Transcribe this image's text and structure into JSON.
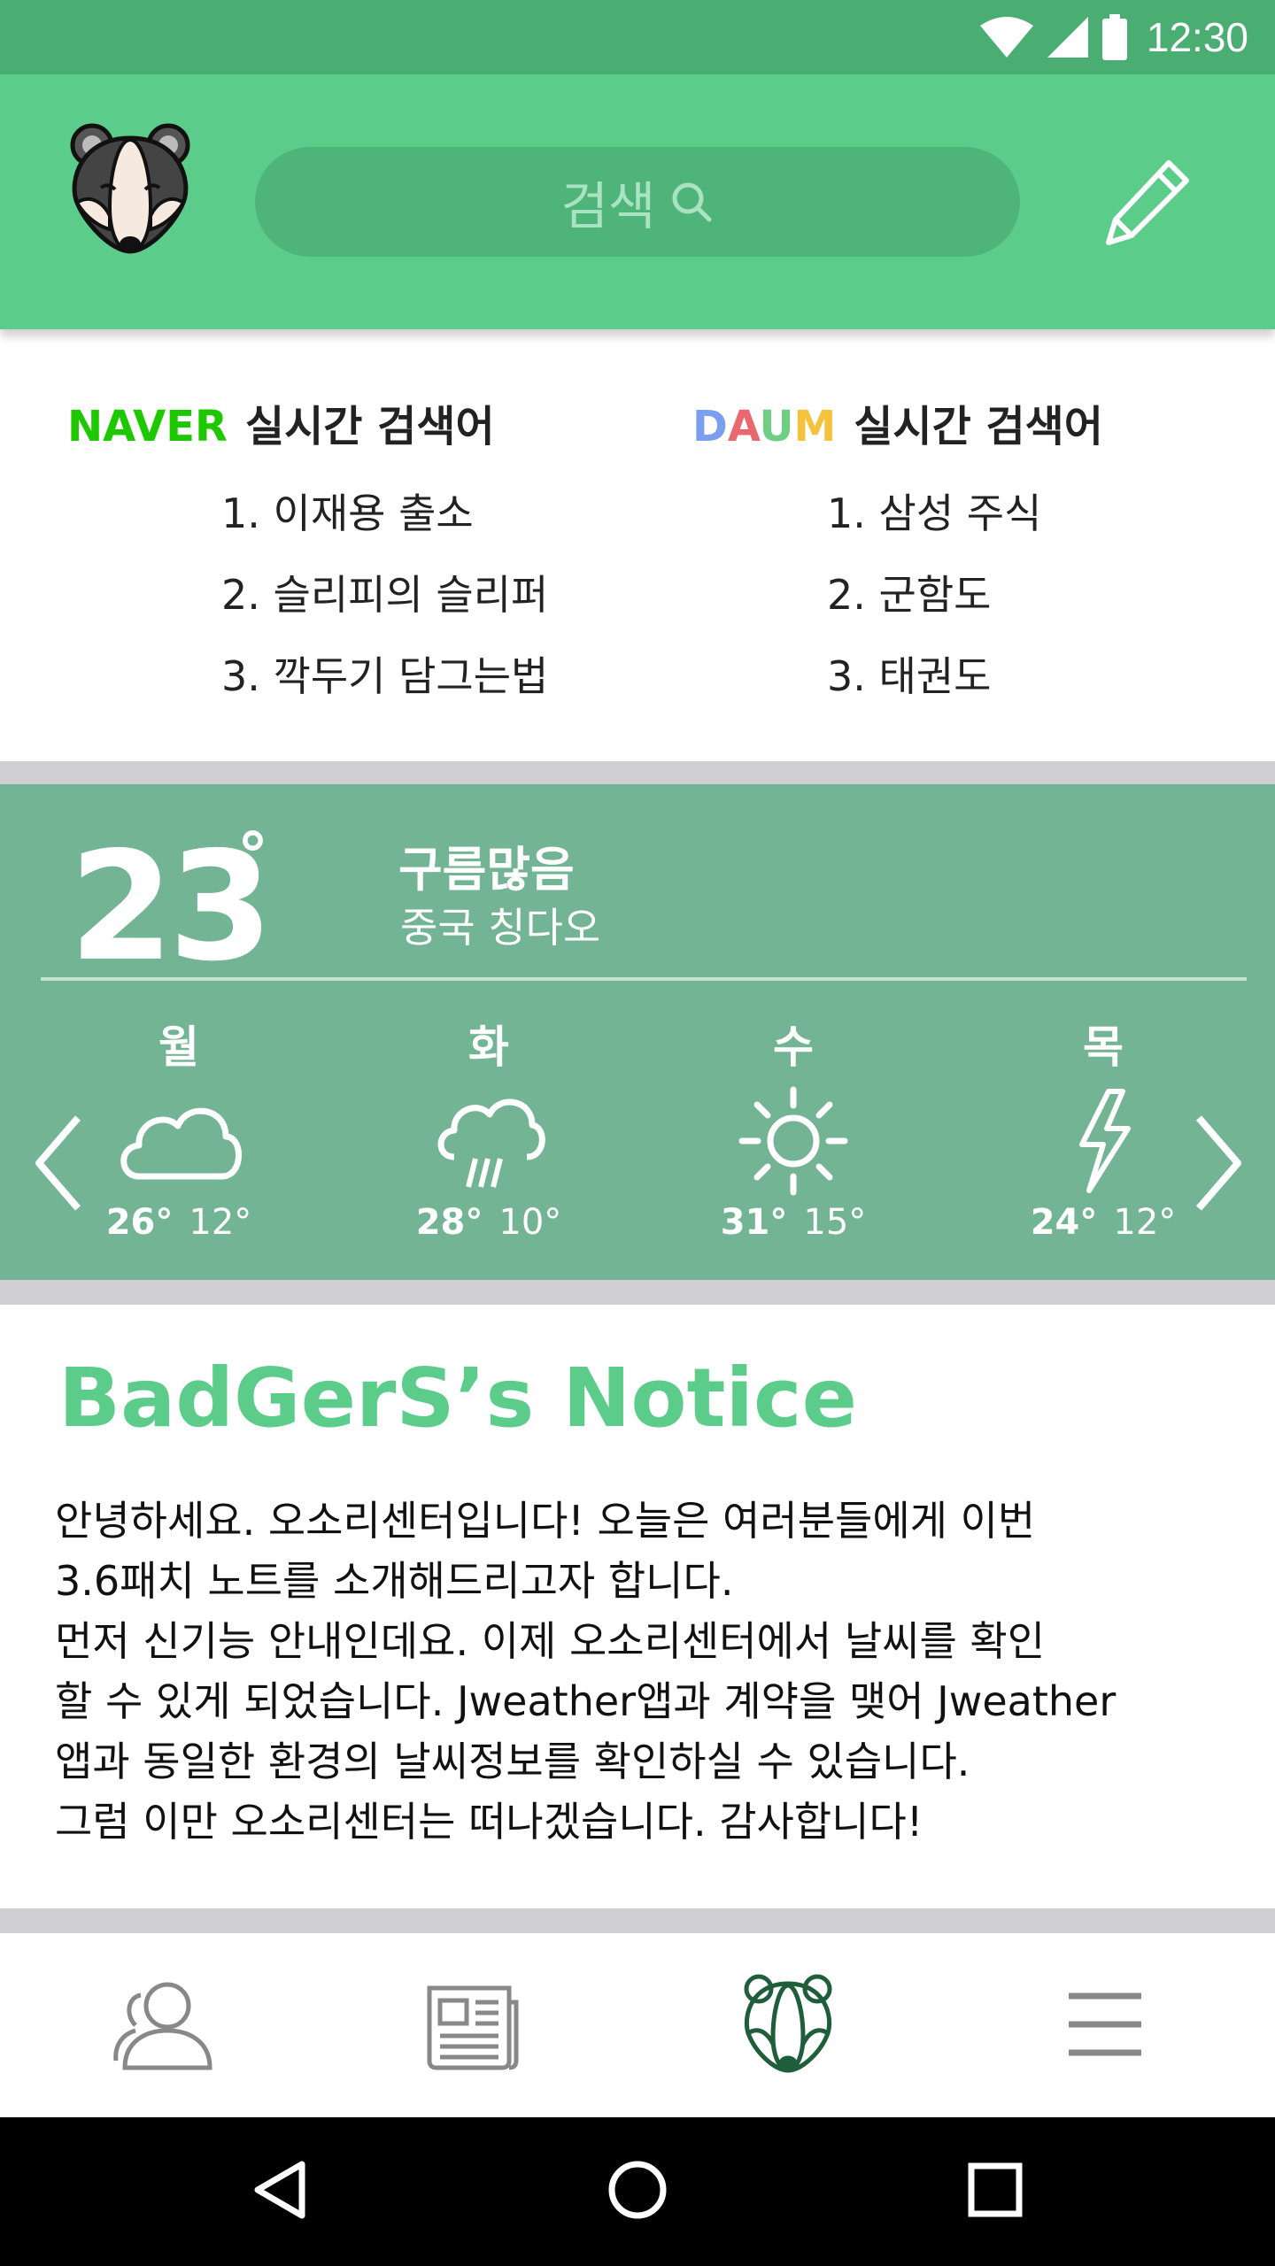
{
  "status_bar": {
    "time": "12:30",
    "icons": [
      "wifi-icon",
      "cellular-signal-icon",
      "battery-icon"
    ]
  },
  "app_bar": {
    "logo": "badger-logo",
    "search": {
      "placeholder": "검색",
      "icon": "search-icon"
    },
    "edit_icon": "pencil-icon",
    "colors": {
      "status_bar": "#4aae72",
      "app_bar": "#5ccc8b",
      "search_bg": "#4fb479"
    }
  },
  "trending": {
    "naver": {
      "brand": "NAVER",
      "title": "실시간 검색어",
      "items": [
        "1. 이재용 출소",
        "2. 슬리피의 슬리퍼",
        "3. 깍두기 담그는법"
      ]
    },
    "daum": {
      "brand_letters": [
        "D",
        "A",
        "U",
        "M"
      ],
      "title": "실시간 검색어",
      "items": [
        "1. 삼성 주식",
        "2. 군함도",
        "3. 태권도"
      ]
    }
  },
  "weather": {
    "current_temp": "23",
    "degree_symbol": "°",
    "condition": "구름많음",
    "location": "중국 칭다오",
    "forecast": [
      {
        "day": "월",
        "icon": "cloud-icon",
        "high": "26°",
        "low": "12°"
      },
      {
        "day": "화",
        "icon": "rain-icon",
        "high": "28°",
        "low": "10°"
      },
      {
        "day": "수",
        "icon": "sun-icon",
        "high": "31°",
        "low": "15°"
      },
      {
        "day": "목",
        "icon": "lightning-icon",
        "high": "24°",
        "low": "12°"
      }
    ],
    "colors": {
      "background": "#72b493"
    }
  },
  "notice": {
    "title": "BadGerS’s Notice",
    "lines": [
      "안녕하세요. 오소리센터입니다! 오늘은 여러분들에게 이번",
      "3.6패치 노트를 소개해드리고자 합니다.",
      "먼저 신기능 안내인데요. 이제 오소리센터에서 날씨를 확인",
      "할 수 있게 되었습니다. Jweather앱과 계약을 맺어 Jweather",
      "앱과 동일한 환경의 날씨정보를 확인하실 수 있습니다.",
      "그럼 이만 오소리센터는 떠나겠습니다. 감사합니다!"
    ],
    "colors": {
      "title": "#5ccc8b"
    }
  },
  "bottom_nav": {
    "items": [
      "people-icon",
      "newspaper-icon",
      "badger-icon",
      "menu-icon"
    ],
    "active_index": 2
  },
  "system_nav": {
    "items": [
      "back-icon",
      "home-icon",
      "recents-icon"
    ]
  }
}
